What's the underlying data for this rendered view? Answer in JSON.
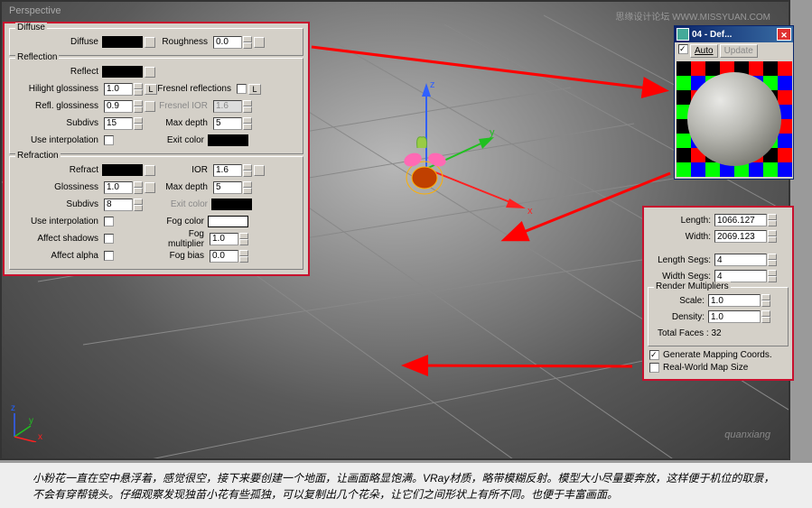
{
  "viewport_label": "Perspective",
  "watermark_top": "思缘设计论坛 WWW.MISSYUAN.COM",
  "watermark_bot": "quanxiang",
  "material": {
    "diffuse": {
      "title": "Diffuse",
      "diffuse_label": "Diffuse",
      "roughness_label": "Roughness",
      "roughness_value": "0.0"
    },
    "reflection": {
      "title": "Reflection",
      "reflect_label": "Reflect",
      "hilight_label": "Hilight glossiness",
      "hilight_value": "1.0",
      "lock_label": "L",
      "fresnel_label": "Fresnel reflections",
      "fresnel_l": "L",
      "refl_gloss_label": "Refl. glossiness",
      "refl_gloss_value": "0.9",
      "fresnel_ior_label": "Fresnel IOR",
      "fresnel_ior_value": "1.6",
      "subdivs_label": "Subdivs",
      "subdivs_value": "15",
      "max_depth_label": "Max depth",
      "max_depth_value": "5",
      "use_interp_label": "Use interpolation",
      "exit_color_label": "Exit color"
    },
    "refraction": {
      "title": "Refraction",
      "refract_label": "Refract",
      "ior_label": "IOR",
      "ior_value": "1.6",
      "glossiness_label": "Glossiness",
      "glossiness_value": "1.0",
      "max_depth_label": "Max depth",
      "max_depth_value": "5",
      "subdivs_label": "Subdivs",
      "subdivs_value": "8",
      "exit_color_label": "Exit color",
      "use_interp_label": "Use interpolation",
      "fog_color_label": "Fog color",
      "affect_shadows_label": "Affect shadows",
      "fog_mult_label": "Fog multiplier",
      "fog_mult_value": "1.0",
      "affect_alpha_label": "Affect alpha",
      "fog_bias_label": "Fog bias",
      "fog_bias_value": "0.0"
    }
  },
  "preview": {
    "title": "04 - Def...",
    "auto_label": "Auto",
    "update_label": "Update"
  },
  "params": {
    "length_label": "Length:",
    "length_value": "1066.127",
    "width_label": "Width:",
    "width_value": "2069.123",
    "lsegs_label": "Length Segs:",
    "lsegs_value": "4",
    "wsegs_label": "Width Segs:",
    "wsegs_value": "4",
    "multipliers_title": "Render Multipliers",
    "scale_label": "Scale:",
    "scale_value": "1.0",
    "density_label": "Density:",
    "density_value": "1.0",
    "total_faces": "Total Faces : 32",
    "gen_map": "Generate Mapping Coords.",
    "real_world": "Real-World Map Size"
  },
  "caption": "小粉花一直在空中悬浮着，感觉很空，接下来要创建一个地面，让画面略显饱满。VRay材质，略带模糊反射。模型大小尽量要奔放，这样便于机位的取景，不会有穿帮镜头。仔细观察发现独苗小花有些孤独，可以复制出几个花朵，让它们之间形状上有所不同。也便于丰富画面。"
}
